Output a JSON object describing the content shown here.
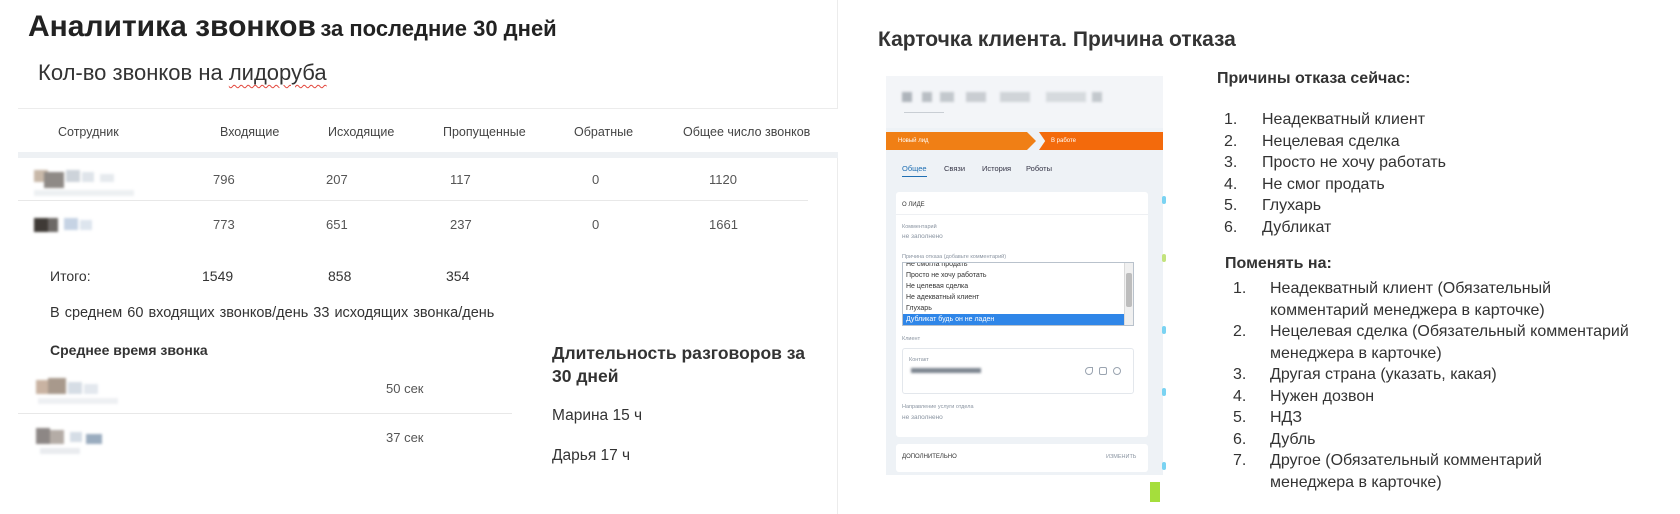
{
  "left_slide": {
    "title_main": "Аналитика звонков",
    "title_period": "за последние 30 дней",
    "subtitle_prefix": "Кол-во звонков на ",
    "subtitle_highlight": "лидоруба",
    "table": {
      "columns": [
        "Сотрудник",
        "Входящие",
        "Исходящие",
        "Пропущенные",
        "Обратные",
        "Общее число звонков"
      ],
      "rows": [
        {
          "employee": "",
          "incoming": "796",
          "outgoing": "207",
          "missed": "117",
          "callback": "0",
          "total": "1120"
        },
        {
          "employee": "",
          "incoming": "773",
          "outgoing": "651",
          "missed": "237",
          "callback": "0",
          "total": "1661"
        }
      ],
      "totals_label": "Итого:",
      "totals": {
        "incoming": "1549",
        "outgoing": "858",
        "missed": "354"
      }
    },
    "average_text": "В среднем 60 входящих  звонков/день   33 исходящих звонка/день",
    "avg_time_title": "Среднее время звонка",
    "avg_time_rows": [
      {
        "employee": "",
        "value": "50 сек"
      },
      {
        "employee": "",
        "value": "37 сек"
      }
    ],
    "duration_title": "Длительность разговоров за 30 дней",
    "duration_items": [
      "Марина 15 ч",
      "Дарья 17 ч"
    ]
  },
  "right_slide": {
    "title": "Карточка клиента. Причина отказа",
    "crm": {
      "stages": [
        "Новый лид",
        "В работе"
      ],
      "tabs": [
        "Общее",
        "Связи",
        "История",
        "Роботы"
      ],
      "about_heading": "О ЛИДЕ",
      "comment_label": "Комментарий",
      "comment_value": "не заполнено",
      "reason_label": "Причина отказа (добавьте комментарий)",
      "reason_options": [
        "Не смогла продать",
        "Просто не хочу работать",
        "Не целевая сделка",
        "Не адекватный клиент",
        "Глухарь",
        "Дубликат будь он не ладен"
      ],
      "reason_selected": "Дубликат будь он не ладен",
      "client_label": "Клиент",
      "contact_label": "Контакт",
      "service_label": "Направление услуги отдела",
      "service_value": "не заполнено",
      "extra_heading": "ДОПОЛНИТЕЛЬНО",
      "extra_action": "ИЗМЕНИТЬ"
    },
    "reasons_title": "Причины отказа сейчас:",
    "reasons_now": [
      "Неадекватный клиент",
      "Нецелевая сделка",
      "Просто не хочу работать",
      "Не смог продать",
      "Глухарь",
      "Дубликат"
    ],
    "change_title": "Поменять на:",
    "change_to": [
      [
        "Неадекватный клиент (Обязательный",
        "комментарий менеджера в карточке)"
      ],
      [
        "Нецелевая сделка (Обязательный комментарий",
        "менеджера в карточке)"
      ],
      [
        "Другая страна (указать, какая)"
      ],
      [
        "Нужен дозвон"
      ],
      [
        "НДЗ"
      ],
      [
        "Дубль"
      ],
      [
        "Другое (Обязательный комментарий",
        "менеджера в карточке)"
      ]
    ],
    "numbers": [
      "1.",
      "2.",
      "3.",
      "4.",
      "5.",
      "6.",
      "7."
    ]
  },
  "colors": {
    "stage_new": "#f07f15",
    "stage_work": "#f36a0c",
    "selection": "#2f86e8",
    "tab_active": "#1f6fb3",
    "spellcheck_underline": "#e2453b"
  }
}
